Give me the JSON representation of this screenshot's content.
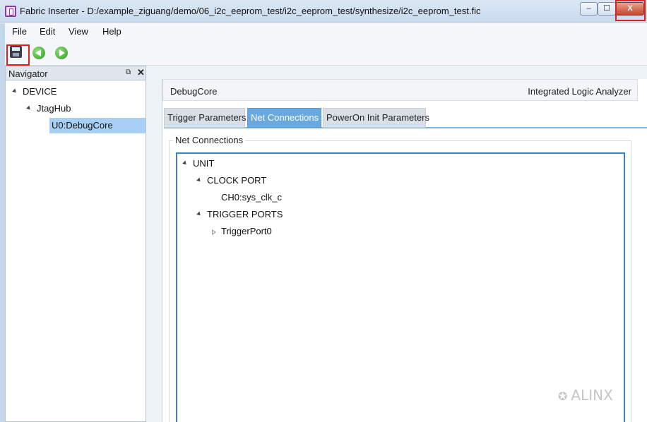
{
  "window": {
    "title": "Fabric Inserter - D:/example_ziguang/demo/06_i2c_eeprom_test/i2c_eeprom_test/synthesize/i2c_eeprom_test.fic",
    "min_label": "‒",
    "max_label": "☐",
    "close_label": "X"
  },
  "menu": {
    "file": "File",
    "edit": "Edit",
    "view": "View",
    "help": "Help"
  },
  "navigator": {
    "title": "Navigator",
    "restore_label": "⧉",
    "close_label": "✕",
    "tree": {
      "device": "DEVICE",
      "jtaghub": "JtagHub",
      "debugcore": "U0:DebugCore"
    }
  },
  "core": {
    "name": "DebugCore",
    "type": "Integrated Logic Analyzer"
  },
  "tabs": {
    "trigger": "Trigger Parameters",
    "net": "Net Connections",
    "poweron": "PowerOn Init Parameters"
  },
  "net_connections": {
    "group_title": "Net Connections",
    "unit": "UNIT",
    "clock_port": "CLOCK PORT",
    "clock_channel": "CH0:sys_clk_c",
    "trigger_ports": "TRIGGER PORTS",
    "trigger_port0": "TriggerPort0"
  },
  "watermark": {
    "icon": "wechat-icon",
    "text": "ALINX"
  },
  "colors": {
    "active_tab": "#6aa8e0",
    "selection": "#a8d0f5",
    "highlight": "#e02020"
  }
}
